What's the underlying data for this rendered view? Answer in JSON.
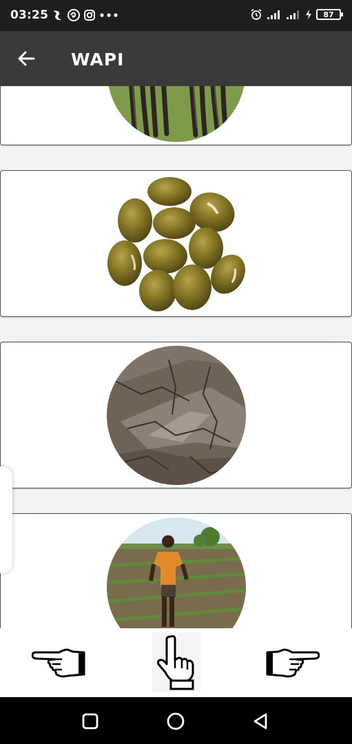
{
  "status_bar": {
    "time": "03:25",
    "battery": "87",
    "icons": [
      "app-notification-icon",
      "app-notification-icon-2",
      "instagram-icon",
      "more-dots-icon",
      "alarm-icon",
      "signal-icon",
      "signal-icon-2",
      "charging-icon",
      "battery-icon"
    ]
  },
  "app_bar": {
    "title": "WAPI",
    "back_icon": "arrow-left-icon"
  },
  "cards": [
    {
      "image": "bean-pods-image"
    },
    {
      "image": "green-beans-image"
    },
    {
      "image": "dry-soil-image"
    },
    {
      "image": "farmer-field-image"
    }
  ],
  "bottom_nav": {
    "prev_icon": "hand-point-left-icon",
    "select_icon": "hand-point-up-icon",
    "next_icon": "hand-point-right-icon"
  },
  "system_nav": [
    "recents-icon",
    "home-icon",
    "back-triangle-icon"
  ],
  "colors": {
    "status_bar_bg": "#1e1e1e",
    "app_bar_bg": "#3a3a3a",
    "card_border": "#3f5550",
    "page_bg": "#f3f3f3"
  }
}
